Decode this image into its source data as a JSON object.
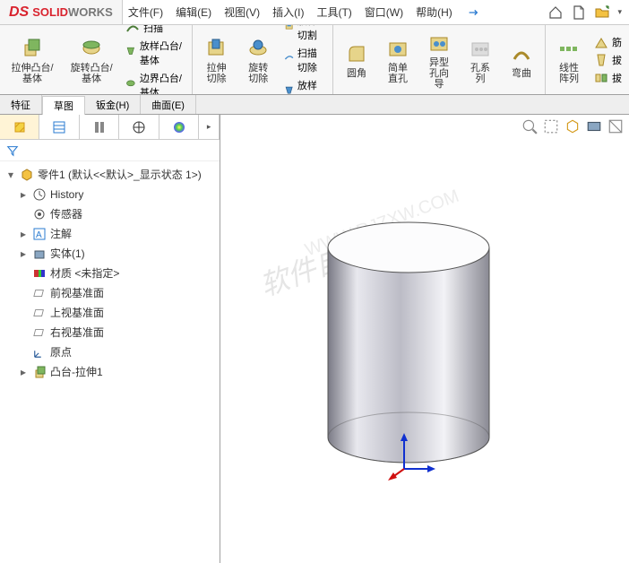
{
  "logo": {
    "ds": "DS",
    "brand": "SOLID",
    "brand2": "WORKS"
  },
  "menu": {
    "file": "文件(F)",
    "edit": "编辑(E)",
    "view": "视图(V)",
    "insert": "插入(I)",
    "tools": "工具(T)",
    "window": "窗口(W)",
    "help": "帮助(H)"
  },
  "ribbon": {
    "extrude": "拉伸凸台/基体",
    "revolve": "旋转凸台/基体",
    "sweep": "扫描",
    "loft": "放样凸台/基体",
    "boundary": "边界凸台/基体",
    "extrudecut": "拉伸切除",
    "revolvecut": "旋转切除",
    "loftcut": "放样切割",
    "sweptcut": "扫描切除",
    "loftcut2": "放样切割",
    "fillet": "圆角",
    "holewizard": "简单直孔",
    "holew2": "异型孔向导",
    "holeseries": "孔系列",
    "wrap": "弯曲",
    "linearpat": "线性阵列",
    "rib": "筋",
    "draft": "拔",
    "mirror": "拔"
  },
  "tabs": {
    "features": "特征",
    "sketch": "草图",
    "sheetmetal": "钣金(H)",
    "surface": "曲面(E)"
  },
  "tree": {
    "root": "零件1  (默认<<默认>_显示状态 1>)",
    "history": "History",
    "sensors": "传感器",
    "annotations": "注解",
    "solidbodies": "实体(1)",
    "material": "材质 <未指定>",
    "front": "前视基准面",
    "top": "上视基准面",
    "right": "右视基准面",
    "origin": "原点",
    "boss": "凸台-拉伸1"
  },
  "watermark": "软件自学网",
  "watermark2": "WWW.RJZXW.COM"
}
